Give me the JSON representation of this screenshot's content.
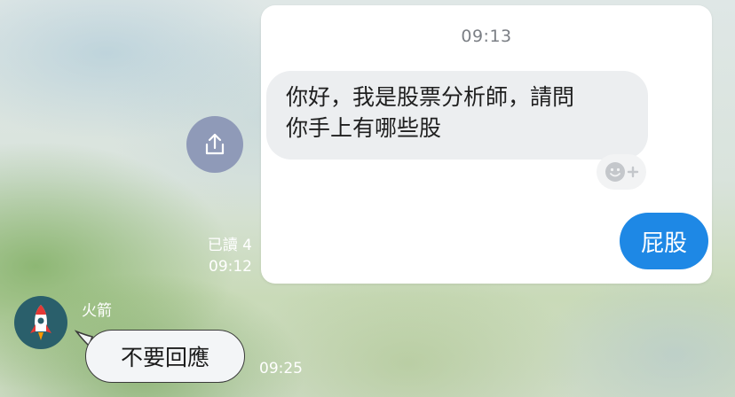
{
  "popup": {
    "timestamp": "09:13",
    "incoming_message": "你好，我是股票分析師，請問\n你手上有哪些股",
    "outgoing_message": "屁股"
  },
  "chat": {
    "read_status": "已讀 4",
    "read_time": "09:12",
    "sender_name": "火箭",
    "reply_message": "不要回應",
    "reply_time": "09:25"
  },
  "colors": {
    "outgoing_bubble": "#1e88e5",
    "incoming_bubble": "#eceef0",
    "share_button": "#8f9ab8",
    "avatar_bg": "#2a5f6b"
  },
  "icons": {
    "share": "share-icon",
    "reaction": "emoji-add-icon",
    "avatar": "rocket-icon"
  }
}
